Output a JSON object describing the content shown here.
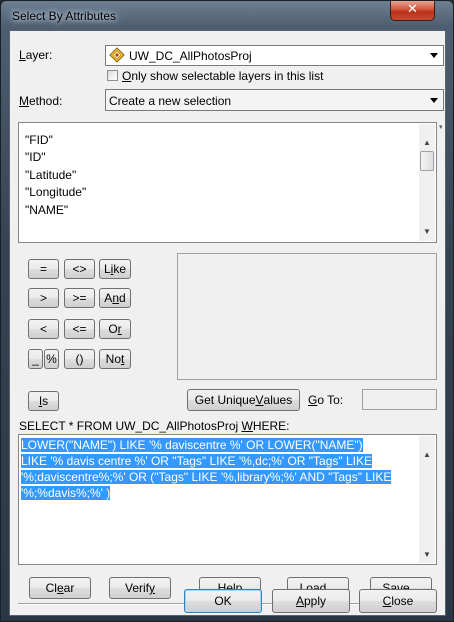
{
  "window": {
    "title": "Select By Attributes",
    "close_glyph": "✕"
  },
  "layer": {
    "label_prefix": "",
    "label_key": "L",
    "label_rest": "ayer:",
    "value": "UW_DC_AllPhotosProj",
    "icon": "layer-diamond-icon",
    "only_selectable_key": "O",
    "only_selectable_rest": "nly show selectable layers in this list",
    "only_selectable_checked": false
  },
  "method": {
    "label_key": "M",
    "label_rest": "ethod:",
    "value": "Create a new selection"
  },
  "fields": [
    "\"FID\"",
    "\"ID\"",
    "\"Latitude\"",
    "\"Longitude\"",
    "\"NAME\""
  ],
  "operators": {
    "eq": "=",
    "ne": "<>",
    "like_a": "L",
    "like_key": "i",
    "like_b": "ke",
    "gt": ">",
    "ge": ">=",
    "and_a": "A",
    "and_key": "n",
    "and_b": "d",
    "lt": "<",
    "le": "<=",
    "or_a": "O",
    "or_key": "r",
    "underscore": "_",
    "percent": "%",
    "parens": "()",
    "not_a": "No",
    "not_key": "t",
    "is_key": "I",
    "is_b": "s"
  },
  "unique_values": {
    "label_a": "Get Unique ",
    "label_key": "V",
    "label_b": "alues"
  },
  "goto": {
    "label_key": "G",
    "label_rest": "o To:",
    "value": ""
  },
  "query": {
    "prefix": "SELECT * FROM UW_DC_AllPhotosProj ",
    "where_key": "W",
    "where_rest": "HERE:",
    "lines": [
      "LOWER(\"NAME\") LIKE '% daviscentre %' OR LOWER(\"NAME\")",
      "LIKE '% davis centre %' OR \"Tags\" LIKE '%,dc;%' OR \"Tags\" LIKE",
      "'%;daviscentre%;%' OR (\"Tags\" LIKE '%,library%;%' AND \"Tags\" LIKE",
      "'%;%davis%;%' )"
    ]
  },
  "actions": {
    "clear_a": "Cl",
    "clear_key": "e",
    "clear_b": "ar",
    "verify_a": "Verif",
    "verify_key": "y",
    "help_key": "H",
    "help_b": "elp",
    "load_a": "Lo",
    "load_key": "a",
    "load_b": "d...",
    "save_a": "Sa",
    "save_key": "v",
    "save_b": "e..."
  },
  "footer": {
    "ok": "OK",
    "apply_key": "A",
    "apply_b": "pply",
    "close_key": "C",
    "close_b": "lose"
  }
}
